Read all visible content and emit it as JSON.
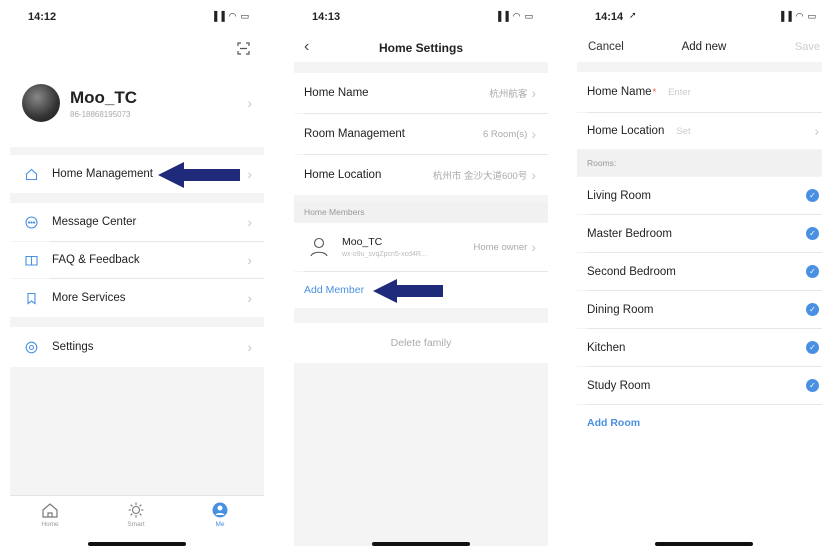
{
  "screen1": {
    "time": "14:12",
    "status_icons": "▐▐ ◠ ▭",
    "user_name": "Moo_TC",
    "user_phone": "86-18868195073",
    "menu": {
      "home_management": "Home Management",
      "message_center": "Message Center",
      "faq_feedback": "FAQ & Feedback",
      "more_services": "More Services",
      "settings": "Settings"
    },
    "tabs": {
      "home": "Home",
      "smart": "Smart",
      "me": "Me"
    }
  },
  "screen2": {
    "time": "14:13",
    "status_icons": "▐▐ ◠ ▭",
    "title": "Home Settings",
    "home_name_label": "Home Name",
    "home_name_value": "杭州航客",
    "room_mgmt_label": "Room Management",
    "room_mgmt_value": "6 Room(s)",
    "home_location_label": "Home Location",
    "home_location_value": "杭州市 金沙大道600号",
    "members_header": "Home Members",
    "member_name": "Moo_TC",
    "member_id": "wx-o9u_svqZpcn5-xcd4R...",
    "member_role": "Home owner",
    "add_member": "Add Member",
    "delete_family": "Delete family"
  },
  "screen3": {
    "time": "14:14",
    "status_icons": "▐▐ ◠ ▭",
    "cancel": "Cancel",
    "title": "Add new",
    "save": "Save",
    "home_name_label": "Home Name",
    "required_mark": "*",
    "home_name_placeholder": "Enter",
    "home_location_label": "Home Location",
    "home_location_placeholder": "Set",
    "rooms_header": "Rooms:",
    "rooms": [
      "Living Room",
      "Master Bedroom",
      "Second Bedroom",
      "Dining Room",
      "Kitchen",
      "Study Room"
    ],
    "add_room": "Add Room"
  },
  "colors": {
    "accent": "#4a90e2",
    "arrow": "#1f2a7a"
  }
}
